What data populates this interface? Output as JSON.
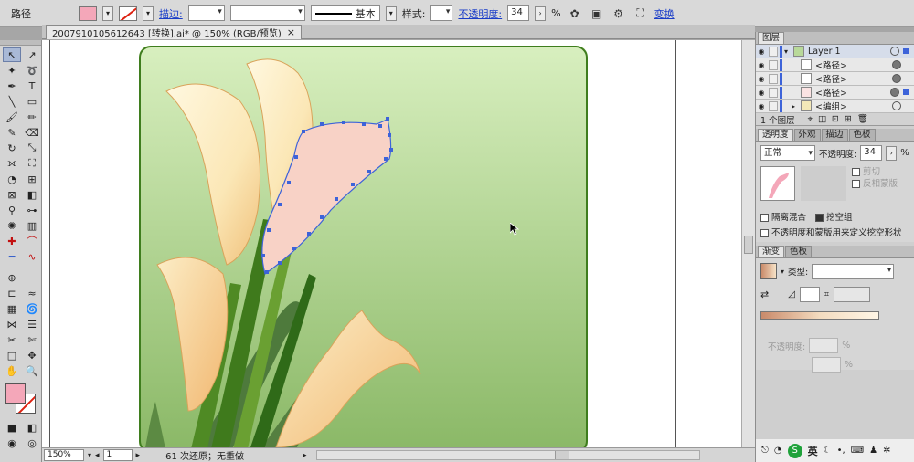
{
  "control_bar": {
    "object_type": "路径",
    "fill_color": "#f4a7b9",
    "stroke_label": "描边:",
    "brush_label": "基本",
    "style_label": "样式:",
    "opacity_label": "不透明度:",
    "opacity_value": "34",
    "opacity_unit": "%",
    "transform_label": "变换"
  },
  "document": {
    "tab_title": "2007910105612643 [转换].ai* @ 150% (RGB/预览)",
    "close_glyph": "×"
  },
  "status": {
    "zoom": "150%",
    "page": "1",
    "history": "61 次还原；无重做"
  },
  "layers_panel": {
    "tab": "图层",
    "layers": [
      {
        "name": "Layer 1",
        "expanded": true
      },
      {
        "name": "<路径>"
      },
      {
        "name": "<路径>"
      },
      {
        "name": "<路径>"
      },
      {
        "name": "<编组>"
      }
    ],
    "footer": "1 个图层"
  },
  "transparency_panel": {
    "tabs": [
      "透明度",
      "外观",
      "描边",
      "色板"
    ],
    "blend_mode": "正常",
    "opacity_label": "不透明度:",
    "opacity_value": "34",
    "clip_label": "剪切",
    "invert_mask_label": "反相蒙版",
    "isolate_label": "隔离混合",
    "knockout_label": "挖空组",
    "opacity_mask_label": "不透明度和蒙版用来定义挖空形状"
  },
  "gradient_panel": {
    "tabs": [
      "渐变",
      "色板"
    ],
    "type_label": "类型:",
    "opacity_label": "不透明度:",
    "opacity_unit": "%"
  },
  "taskbar": {
    "ime": "英"
  },
  "colors": {
    "selection_blue": "#3d63d9",
    "fill_pink": "#f4a7b9",
    "canvas_green_top": "#d8efbf",
    "canvas_green_bottom": "#8ab866"
  }
}
